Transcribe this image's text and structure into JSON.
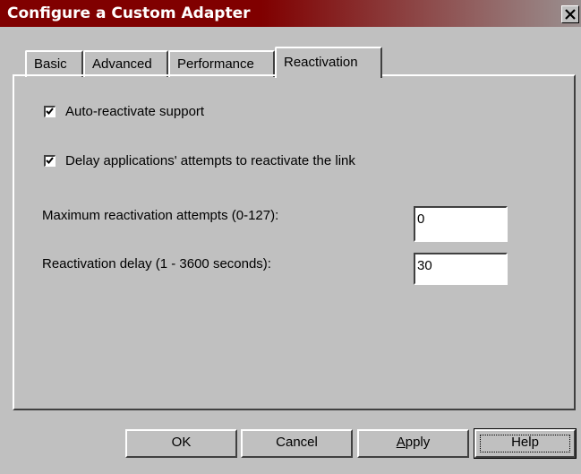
{
  "window": {
    "title": "Configure a Custom Adapter"
  },
  "tabs": [
    {
      "label": "Basic"
    },
    {
      "label": "Advanced"
    },
    {
      "label": "Performance"
    },
    {
      "label": "Reactivation",
      "active": true
    }
  ],
  "reactivation": {
    "auto_reactivate": {
      "label": "Auto-reactivate support",
      "checked": true
    },
    "delay_apps": {
      "label": "Delay applications' attempts to reactivate the link",
      "checked": true
    },
    "max_attempts": {
      "label": "Maximum reactivation attempts (0-127):",
      "value": "0"
    },
    "delay": {
      "label": "Reactivation delay (1 - 3600 seconds):",
      "value": "30"
    }
  },
  "buttons": {
    "ok": "OK",
    "cancel": "Cancel",
    "apply_mnemonic": "A",
    "apply_rest": "pply",
    "help": "Help"
  }
}
